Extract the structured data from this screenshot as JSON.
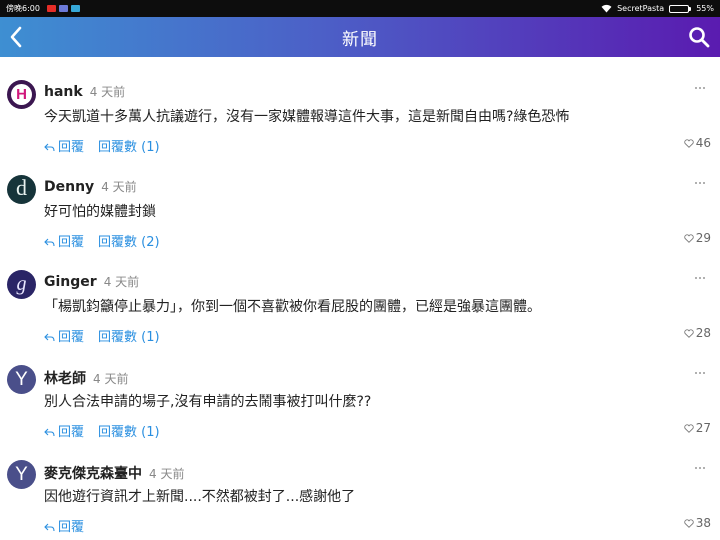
{
  "status": {
    "time": "傍晚6:00",
    "carrier": "SecretPasta",
    "battery": "55%",
    "battery_level": 0.55
  },
  "header": {
    "title": "新聞",
    "back_icon": "chevron-left-icon",
    "search_icon": "search-icon"
  },
  "labels": {
    "reply": "回覆"
  },
  "comments": [
    {
      "author": "hank",
      "time": "4 天前",
      "text": "今天凱道十多萬人抗議遊行，沒有一家媒體報導這件大事，這是新聞自由嗎?綠色恐怖",
      "reply_count": "回覆數 (1)",
      "likes": "46",
      "avatar_letter": "H"
    },
    {
      "author": "Denny",
      "time": "4 天前",
      "text": "好可怕的媒體封鎖",
      "reply_count": "回覆數 (2)",
      "likes": "29",
      "avatar_letter": "d"
    },
    {
      "author": "Ginger",
      "time": "4 天前",
      "text": "「楊凱鈞籲停止暴力」，你到一個不喜歡被你看屁股的團體，已經是強暴這團體。",
      "reply_count": "回覆數 (1)",
      "likes": "28",
      "avatar_letter": "g"
    },
    {
      "author": "林老師",
      "time": "4 天前",
      "text": "別人合法申請的場子,沒有申請的去鬧事被打叫什麼??",
      "reply_count": "回覆數 (1)",
      "likes": "27",
      "avatar_letter": "Y"
    },
    {
      "author": "麥克傑克森臺中",
      "time": "4 天前",
      "text": "因他遊行資訊才上新聞....不然都被封了...感謝他了",
      "reply_count": "",
      "likes": "38",
      "avatar_letter": "Y"
    }
  ],
  "colors": {
    "link": "#2a8fe0",
    "header_start": "#3e8fd2",
    "header_end": "#5a1bb0"
  }
}
